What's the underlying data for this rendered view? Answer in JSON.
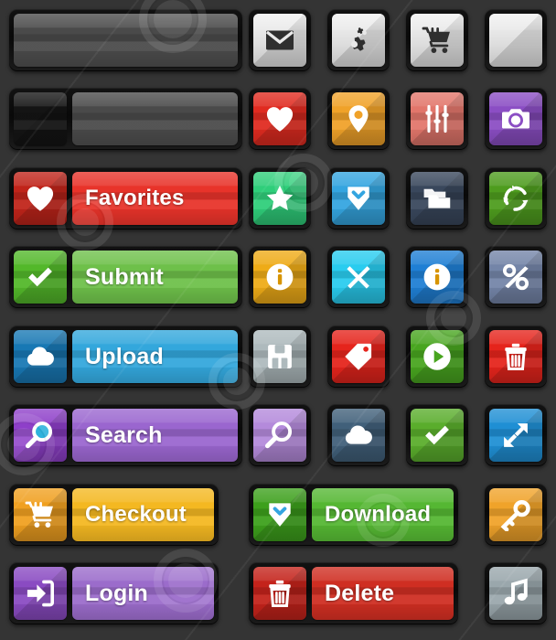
{
  "sheet": {
    "title": "Flat UI Button Set",
    "background_color": "#343434",
    "plate_color": "#0d0d0d",
    "text_color": "#ffffff"
  },
  "rows": [
    {
      "id": "row-1",
      "wide": [
        {
          "name": "blank-wide-button",
          "label": "",
          "icon": "",
          "icon_color": "",
          "face_color": "#4a4a4a",
          "style": "plain-wide"
        }
      ],
      "icons": [
        {
          "name": "mail-button",
          "icon": "envelope-icon",
          "face_color": "#e8e8e8",
          "glyph_color": "#2f2f2f"
        },
        {
          "name": "settings-button",
          "icon": "gears-icon",
          "face_color": "#e8e8e8",
          "glyph_color": "#2f2f2f"
        },
        {
          "name": "cart-button",
          "icon": "shopping-cart-icon",
          "face_color": "#e8e8e8",
          "glyph_color": "#2f2f2f"
        },
        {
          "name": "blank-button",
          "icon": "blank-icon",
          "face_color": "#e8e8e8",
          "glyph_color": "#e8e8e8"
        }
      ]
    },
    {
      "id": "row-2",
      "wide": [
        {
          "name": "blank-split-button",
          "label": "",
          "icon": "blank-icon",
          "icon_color": "#141414",
          "face_color": "#4a4a4a",
          "style": "split-wide"
        }
      ],
      "icons": [
        {
          "name": "favorite-button",
          "icon": "heart-icon",
          "face_color": "#e02b20",
          "glyph_color": "#ffffff"
        },
        {
          "name": "location-button",
          "icon": "map-pin-icon",
          "face_color": "#f0a229",
          "glyph_color": "#ffffff"
        },
        {
          "name": "settings-sliders-button",
          "icon": "sliders-icon",
          "face_color": "#e2766b",
          "glyph_color": "#ffffff"
        },
        {
          "name": "camera-button",
          "icon": "camera-icon",
          "face_color": "#8b4ec4",
          "glyph_color": "#ffffff"
        }
      ]
    },
    {
      "id": "row-3",
      "wide": [
        {
          "name": "favorites-button",
          "label": "Favorites",
          "icon": "heart-icon",
          "icon_color": "#c0241a",
          "face_color": "#e8332a",
          "style": "split-wide"
        }
      ],
      "icons": [
        {
          "name": "star-button",
          "icon": "star-icon",
          "face_color": "#2fce7a",
          "glyph_color": "#ffffff"
        },
        {
          "name": "download-button",
          "icon": "download-icon",
          "face_color": "#34a5e0",
          "glyph_color": "#ffffff"
        },
        {
          "name": "folder-button",
          "icon": "folders-icon",
          "face_color": "#39475c",
          "glyph_color": "#ffffff"
        },
        {
          "name": "refresh-button",
          "icon": "recycle-icon",
          "face_color": "#4e9c1e",
          "glyph_color": "#ffffff"
        }
      ]
    },
    {
      "id": "row-4",
      "wide": [
        {
          "name": "submit-button",
          "label": "Submit",
          "icon": "check-icon",
          "icon_color": "#53b82a",
          "face_color": "#6ec04a",
          "style": "split-wide"
        }
      ],
      "icons": [
        {
          "name": "info-amber-button",
          "icon": "info-icon",
          "face_color": "#eeab17",
          "glyph_color": "#ffffff"
        },
        {
          "name": "close-button",
          "icon": "close-x-icon",
          "face_color": "#29ccef",
          "glyph_color": "#ffffff"
        },
        {
          "name": "info-blue-button",
          "icon": "info-icon",
          "face_color": "#1f7fd4",
          "glyph_color": "#ffffff"
        },
        {
          "name": "percent-button",
          "icon": "percent-icon",
          "face_color": "#7485a8",
          "glyph_color": "#ffffff"
        }
      ]
    },
    {
      "id": "row-5",
      "wide": [
        {
          "name": "upload-button",
          "label": "Upload",
          "icon": "cloud-upload-icon",
          "icon_color": "#1878b4",
          "face_color": "#33a7dc",
          "style": "split-wide"
        }
      ],
      "icons": [
        {
          "name": "save-button",
          "icon": "floppy-disk-icon",
          "face_color": "#aebabd",
          "glyph_color": "#ffffff"
        },
        {
          "name": "tag-button",
          "icon": "tag-icon",
          "face_color": "#e5241c",
          "glyph_color": "#ffffff"
        },
        {
          "name": "play-button",
          "icon": "play-icon",
          "face_color": "#48a51f",
          "glyph_color": "#ffffff"
        },
        {
          "name": "delete-button",
          "icon": "trash-icon",
          "face_color": "#e5241c",
          "glyph_color": "#ffffff"
        }
      ]
    },
    {
      "id": "row-6",
      "wide": [
        {
          "name": "search-button",
          "label": "Search",
          "icon": "magnifier-icon",
          "icon_color": "#8e3fc9",
          "face_color": "#9a66cf",
          "style": "split-wide"
        }
      ],
      "icons": [
        {
          "name": "search-light-button",
          "icon": "magnifier-plain-icon",
          "face_color": "#b48adb",
          "glyph_color": "#ffffff"
        },
        {
          "name": "cloud-upload-button",
          "icon": "cloud-upload-icon",
          "face_color": "#41607a",
          "glyph_color": "#ffffff"
        },
        {
          "name": "confirm-button",
          "icon": "check-icon",
          "face_color": "#5aad2c",
          "glyph_color": "#ffffff"
        },
        {
          "name": "expand-button",
          "icon": "expand-arrows-icon",
          "face_color": "#1f8fd4",
          "glyph_color": "#ffffff"
        }
      ]
    },
    {
      "id": "row-7",
      "wide": [
        {
          "name": "checkout-button",
          "label": "Checkout",
          "icon": "shopping-cart-icon",
          "icon_color": "#f0a020",
          "face_color": "#f4b821",
          "style": "split-wide"
        },
        {
          "name": "download-wide-button",
          "label": "Download",
          "icon": "download-icon",
          "icon_color": "#3da01c",
          "face_color": "#55b733",
          "style": "split-wide"
        }
      ],
      "icons": [
        {
          "name": "key-button",
          "icon": "key-icon",
          "face_color": "#f0a32a",
          "glyph_color": "#ffffff"
        }
      ]
    },
    {
      "id": "row-8",
      "wide": [
        {
          "name": "login-button",
          "label": "Login",
          "icon": "sign-in-icon",
          "icon_color": "#8a4bc2",
          "face_color": "#9b6ccb",
          "style": "split-wide"
        },
        {
          "name": "delete-wide-button",
          "label": "Delete",
          "icon": "trash-icon",
          "icon_color": "#c4231b",
          "face_color": "#cf2e22",
          "style": "split-wide"
        }
      ],
      "icons": [
        {
          "name": "music-button",
          "icon": "music-note-icon",
          "face_color": "#9aa7ac",
          "glyph_color": "#ffffff"
        }
      ]
    }
  ]
}
